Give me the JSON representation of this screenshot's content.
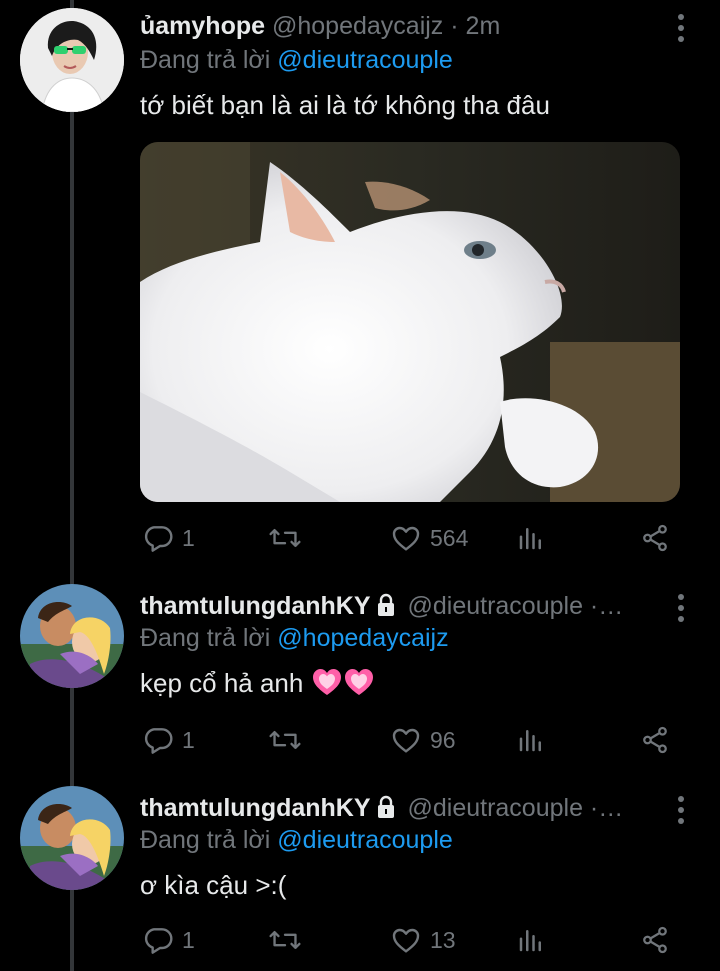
{
  "tweets": [
    {
      "name": "ủamyhope",
      "handle": "@hopedaycaijz",
      "time": "· 2m",
      "reply_prefix": "Đang trả lời",
      "reply_to": "@dieutracouple",
      "text": "tớ biết bạn là ai là tớ không tha đâu",
      "replies": "1",
      "retweets": "",
      "likes": "564",
      "has_media": true
    },
    {
      "name": "thamtulungdanhKY",
      "handle": "@dieutracouple ·…",
      "reply_prefix": "Đang trả lời",
      "reply_to": "@hopedaycaijz",
      "text": "kẹp cổ hả anh",
      "replies": "1",
      "retweets": "",
      "likes": "96"
    },
    {
      "name": "thamtulungdanhKY",
      "handle": "@dieutracouple ·…",
      "reply_prefix": "Đang trả lời",
      "reply_to": "@dieutracouple",
      "text": "ơ kìa cậu >:(",
      "replies": "1",
      "retweets": "",
      "likes": "13"
    }
  ],
  "colors": {
    "background": "#000000",
    "text": "#e7e9ea",
    "secondary": "#71767b",
    "link": "#1d9bf0",
    "heart_emoji": "#ff5fa8"
  },
  "icons": [
    "reply-icon",
    "retweet-icon",
    "like-icon",
    "analytics-icon",
    "share-icon",
    "more-icon",
    "lock-icon",
    "heart-emoji"
  ]
}
